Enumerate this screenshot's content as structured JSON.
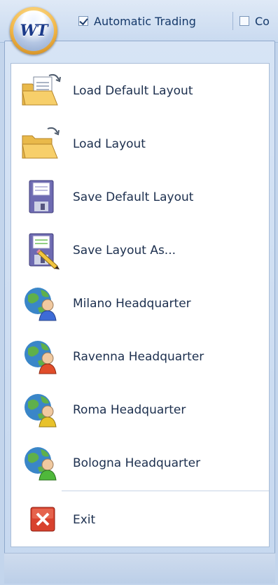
{
  "app": {
    "orb_label": "WT"
  },
  "quick_access": {
    "automatic_trading": {
      "label": "Automatic Trading",
      "checked": true
    },
    "second_option": {
      "label": "Co",
      "checked": false
    }
  },
  "menu": {
    "items": [
      {
        "label": "Load Default Layout",
        "icon": "load-document-icon"
      },
      {
        "label": "Load Layout",
        "icon": "open-folder-icon"
      },
      {
        "label": "Save Default Layout",
        "icon": "floppy-disk-icon"
      },
      {
        "label": "Save Layout As...",
        "icon": "floppy-disk-pencil-icon"
      },
      {
        "label": "Milano Headquarter",
        "icon": "globe-user-blue-icon",
        "color": "#3d6bd6"
      },
      {
        "label": "Ravenna Headquarter",
        "icon": "globe-user-red-icon",
        "color": "#e14d2a"
      },
      {
        "label": "Roma Headquarter",
        "icon": "globe-user-yellow-icon",
        "color": "#e8c22a"
      },
      {
        "label": "Bologna Headquarter",
        "icon": "globe-user-green-icon",
        "color": "#4fb83b"
      }
    ],
    "exit": {
      "label": "Exit",
      "icon": "exit-x-icon"
    }
  }
}
